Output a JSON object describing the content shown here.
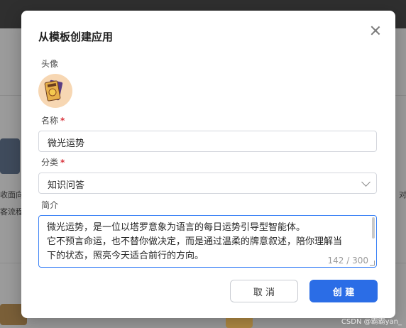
{
  "background": {
    "left_snippets": [
      "收面向",
      "客流程。"
    ],
    "right_snippet": "对"
  },
  "modal": {
    "title": "从模板创建应用",
    "avatar": {
      "label": "头像",
      "image": "tarot-card-avatar"
    },
    "name": {
      "label": "名称",
      "required_mark": "*",
      "value": "微光运势"
    },
    "category": {
      "label": "分类",
      "required_mark": "*",
      "value": "知识问答"
    },
    "intro": {
      "label": "简介",
      "lines": [
        "微光运势，是一位以塔罗意象为语言的每日运势引导型智能体。",
        "它不预言命运，也不替你做决定，而是通过温柔的牌意叙述，陪你理解当",
        "下的状态，照亮今天适合前行的方向。"
      ],
      "counter": "142 / 300"
    },
    "buttons": {
      "cancel": "取 消",
      "create": "创 建"
    },
    "colors": {
      "primary": "#2b6de6",
      "required": "#d9363e"
    }
  },
  "watermark": "CSDN @霸霸yan_"
}
